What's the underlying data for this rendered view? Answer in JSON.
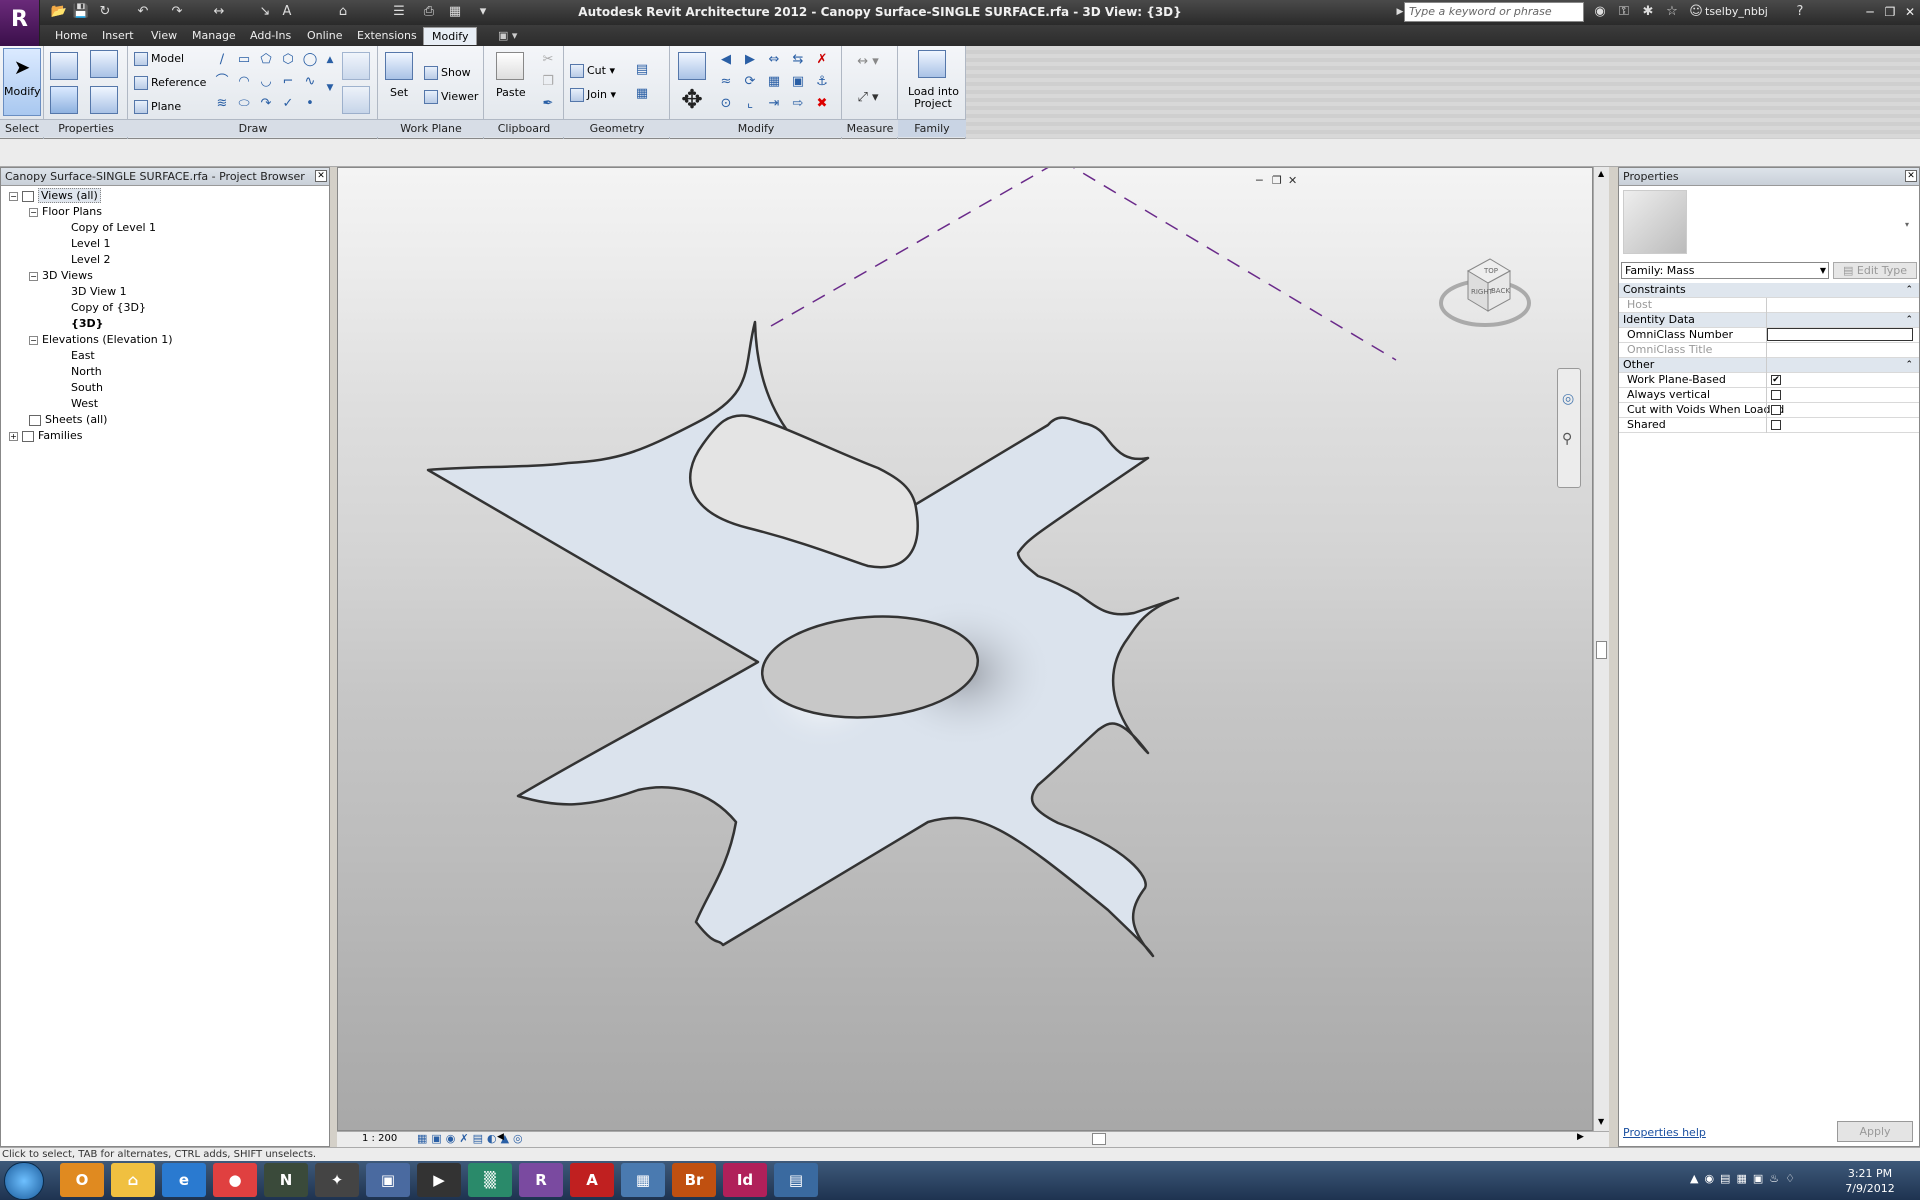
{
  "window": {
    "title": "Autodesk Revit Architecture 2012 -    Canopy Surface-SINGLE SURFACE.rfa - 3D View: {3D}",
    "search_placeholder": "Type a keyword or phrase",
    "user": "tselby_nbbj"
  },
  "tabs": [
    "Home",
    "Insert",
    "View",
    "Manage",
    "Add-Ins",
    "Online",
    "Extensions",
    "Modify"
  ],
  "active_tab": "Modify",
  "ribbon": {
    "select": {
      "label": "Select",
      "modify": "Modify"
    },
    "properties": {
      "label": "Properties"
    },
    "draw": {
      "label": "Draw",
      "model": "Model",
      "reference": "Reference",
      "plane": "Plane"
    },
    "work_plane": {
      "label": "Work Plane",
      "set": "Set",
      "show": "Show",
      "viewer": "Viewer"
    },
    "clipboard": {
      "label": "Clipboard",
      "paste": "Paste"
    },
    "geometry": {
      "label": "Geometry",
      "cut": "Cut",
      "join": "Join"
    },
    "modify": {
      "label": "Modify"
    },
    "measure": {
      "label": "Measure"
    },
    "family_editor": {
      "label": "Family Editor",
      "load_line1": "Load into",
      "load_line2": "Project"
    }
  },
  "project_browser": {
    "title": "Canopy Surface-SINGLE SURFACE.rfa - Project Browser",
    "root": "Views (all)",
    "floor_plans": "Floor Plans",
    "floor_plan_items": [
      "Copy of Level 1",
      "Level 1",
      "Level 2"
    ],
    "views_3d": "3D Views",
    "views_3d_items": [
      "3D View 1",
      "Copy of {3D}",
      "{3D}"
    ],
    "elevations": "Elevations (Elevation 1)",
    "elevation_items": [
      "East",
      "North",
      "South",
      "West"
    ],
    "sheets": "Sheets (all)",
    "families": "Families"
  },
  "viewcube": {
    "face_right": "RIGHT",
    "face_back": "BACK",
    "face_top": "TOP"
  },
  "view_control": {
    "scale": "1 : 200"
  },
  "properties_panel": {
    "title": "Properties",
    "type_selector": "Family: Mass",
    "edit_type": "Edit Type",
    "constraints": "Constraints",
    "host": "Host",
    "identity_data": "Identity Data",
    "omniclass_number": "OmniClass Number",
    "omniclass_title": "OmniClass Title",
    "other": "Other",
    "work_plane_based": "Work Plane-Based",
    "always_vertical": "Always vertical",
    "cut_with_voids": "Cut with Voids When Loaded",
    "shared": "Shared",
    "help_link": "Properties help",
    "apply": "Apply"
  },
  "checkboxes": {
    "work_plane_based": true,
    "always_vertical": false,
    "cut_with_voids": false,
    "shared": false
  },
  "status": {
    "text": "Click to select, TAB for alternates, CTRL adds, SHIFT unselects."
  },
  "taskbar": {
    "apps": [
      "O",
      "⌂",
      "e",
      "●",
      "N",
      "✦",
      "▣",
      "▶",
      "▒",
      "R",
      "A",
      "▦",
      "Br",
      "Id",
      "▤"
    ],
    "time": "3:21 PM",
    "date": "7/9/2012"
  },
  "colors": {
    "accent": "#5b2a6a",
    "selection": "#a9c8f0",
    "surface": "#dbe3ed",
    "dashed": "#6a2a8a"
  }
}
